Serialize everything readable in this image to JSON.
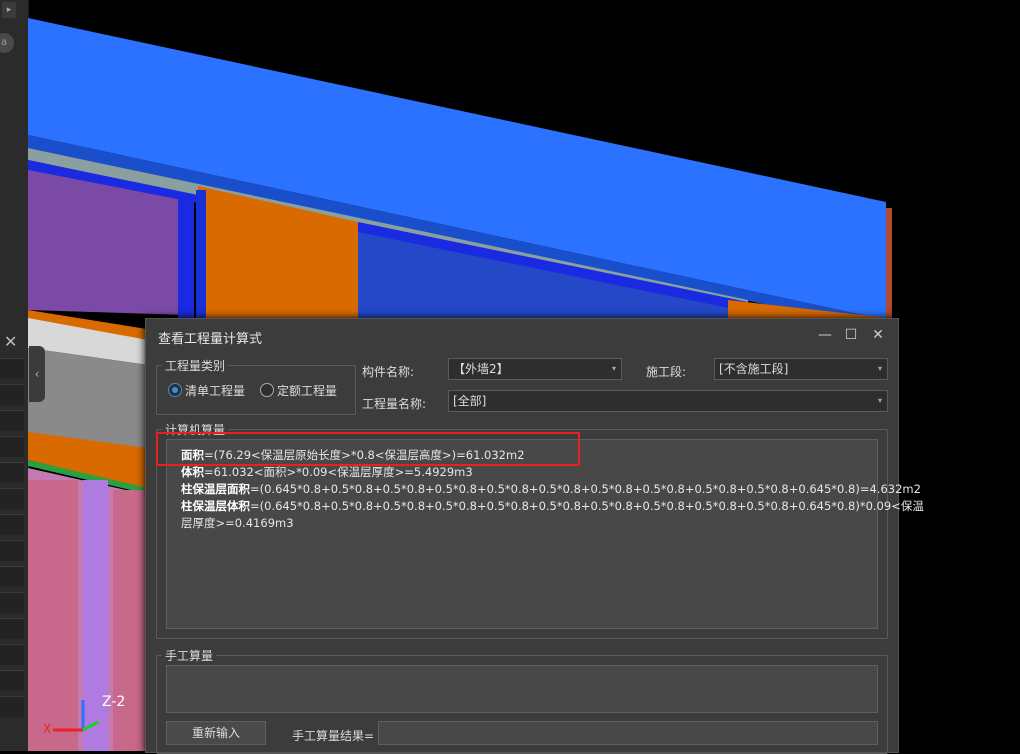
{
  "dialog": {
    "title": "查看工程量计算式",
    "minimize_icon": "minimize-icon",
    "maximize_icon": "maximize-icon",
    "close_icon": "close-icon"
  },
  "quantity_type": {
    "group_label": "工程量类别",
    "options": [
      "清单工程量",
      "定额工程量"
    ],
    "selected": "清单工程量"
  },
  "component": {
    "label": "构件名称:",
    "value": "【外墙2】"
  },
  "construction_stage": {
    "label": "施工段:",
    "value": "[不含施工段]"
  },
  "quantity_name": {
    "label": "工程量名称:",
    "value": "[全部]"
  },
  "computer_calc": {
    "group_label": "计算机算量",
    "lines": [
      {
        "name": "面积",
        "formula": "=(76.29<保温层原始长度>*0.8<保温层高度>)=61.032m2"
      },
      {
        "name": "体积",
        "formula": "=61.032<面积>*0.09<保温层厚度>=5.4929m3"
      },
      {
        "name": "柱保温层面积",
        "formula": "=(0.645*0.8+0.5*0.8+0.5*0.8+0.5*0.8+0.5*0.8+0.5*0.8+0.5*0.8+0.5*0.8+0.5*0.8+0.5*0.8+0.645*0.8)=4.632m2"
      },
      {
        "name": "柱保温层体积",
        "formula": "=(0.645*0.8+0.5*0.8+0.5*0.8+0.5*0.8+0.5*0.8+0.5*0.8+0.5*0.8+0.5*0.8+0.5*0.8+0.5*0.8+0.645*0.8)*0.09<保温"
      },
      {
        "name": "",
        "formula": "层厚度>=0.4169m3"
      }
    ]
  },
  "manual_calc": {
    "group_label": "手工算量",
    "reenter_button": "重新输入",
    "result_label": "手工算量结果="
  },
  "viewport": {
    "axis_label": "Z-2",
    "colors": {
      "wall_blue": "#1f6bff",
      "column_orange": "#d86a00",
      "slab_pink": "#c47ab0",
      "window_purple": "#7a4aa6",
      "highlight_red": "#e52222"
    }
  }
}
